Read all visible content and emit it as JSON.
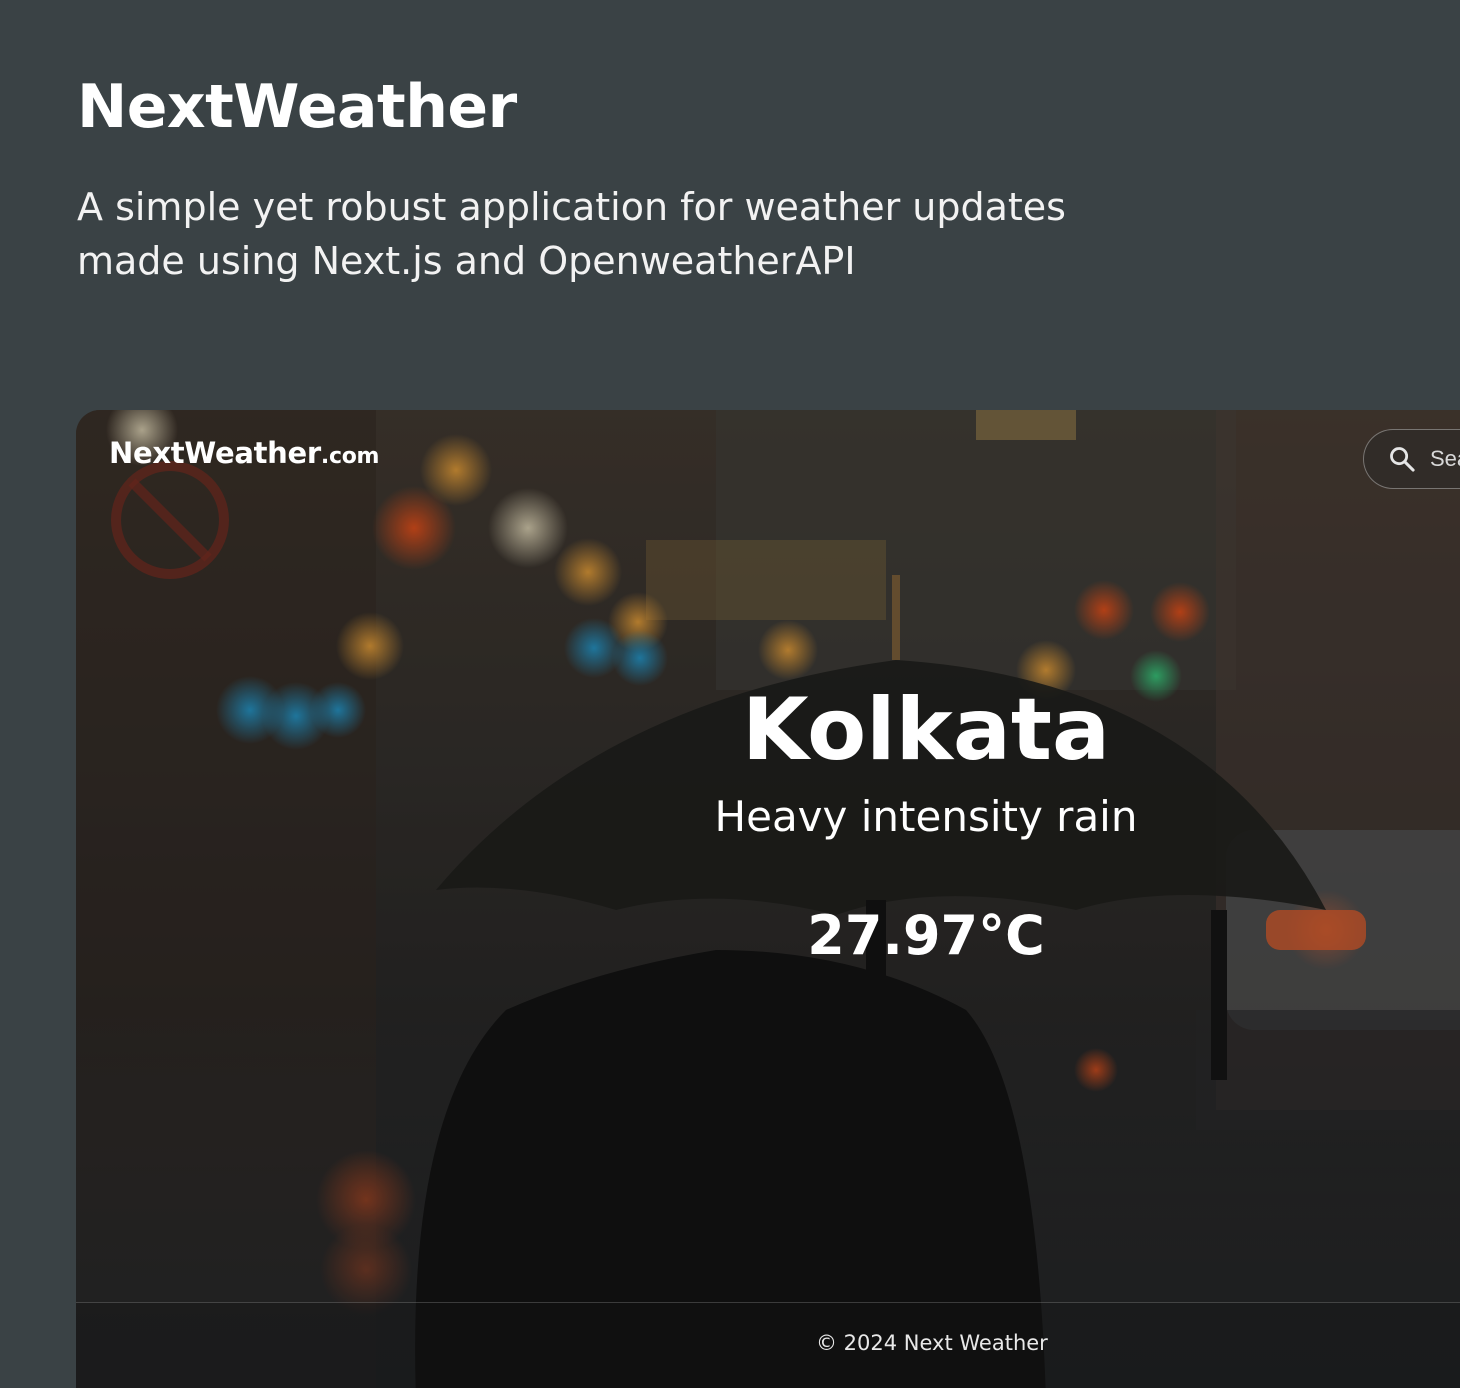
{
  "hero": {
    "title": "NextWeather",
    "description": "A simple yet robust application for weather updates made using Next.js and OpenweatherAPI"
  },
  "app": {
    "brand_name": "NextWeather",
    "brand_tld": ".com",
    "search": {
      "placeholder": "Search",
      "icon": "search-icon"
    },
    "weather": {
      "city": "Kolkata",
      "condition": "Heavy intensity rain",
      "temperature": "27.97°C"
    },
    "footer": {
      "copyright": "© 2024 Next Weather"
    }
  },
  "colors": {
    "page_background": "#3a4245",
    "text": "#ffffff"
  }
}
